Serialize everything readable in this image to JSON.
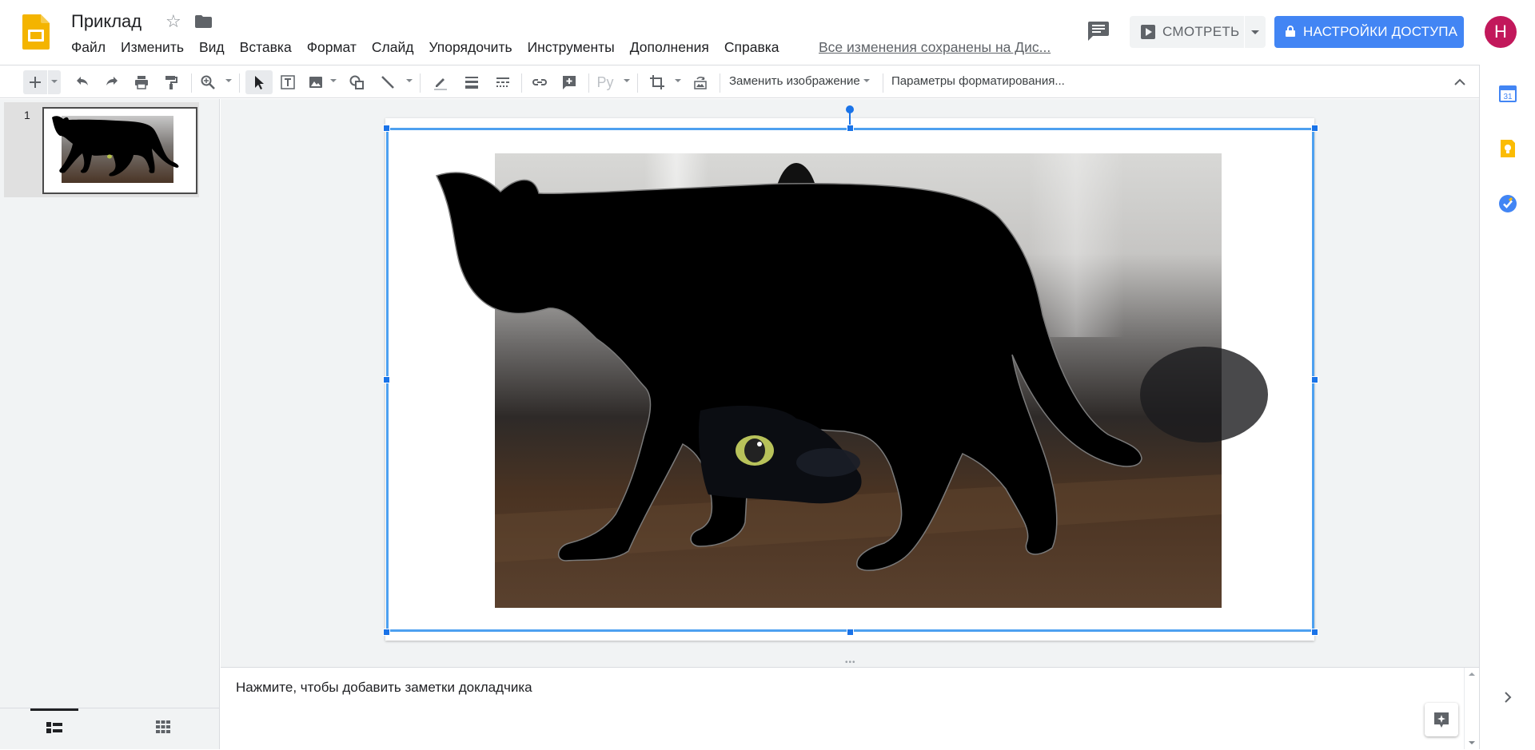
{
  "app": {
    "name": "Google Slides",
    "brand_color": "#f4b400"
  },
  "document": {
    "title": "Приклад",
    "save_status": "Все изменения сохранены на Дис..."
  },
  "menu": [
    "Файл",
    "Изменить",
    "Вид",
    "Вставка",
    "Формат",
    "Слайд",
    "Упорядочить",
    "Инструменты",
    "Дополнения",
    "Справка"
  ],
  "header": {
    "present_label": "СМОТРЕТЬ",
    "share_label": "НАСТРОЙКИ ДОСТУПА",
    "share_color": "#4285f4",
    "avatar_initial": "Н",
    "avatar_color": "#c2185b"
  },
  "toolbar": {
    "replace_image_label": "Заменить изображение",
    "format_options_label": "Параметры форматирования...",
    "icons": [
      "plus-icon",
      "undo-icon",
      "redo-icon",
      "print-icon",
      "paint-format-icon",
      "zoom-icon",
      "select-icon",
      "textbox-icon",
      "image-icon",
      "shape-icon",
      "line-icon",
      "pen-icon",
      "line-weight-icon",
      "line-dash-icon",
      "link-icon",
      "comment-add-icon",
      "spell-icon",
      "crop-icon",
      "reset-image-icon",
      "chevron-up-icon"
    ],
    "spellcheck_label": "Ру"
  },
  "filmstrip": {
    "slides": [
      {
        "number": "1"
      }
    ]
  },
  "notes": {
    "placeholder": "Нажмите, чтобы добавить заметки докладчика"
  },
  "selection_color": "#4da0f0"
}
